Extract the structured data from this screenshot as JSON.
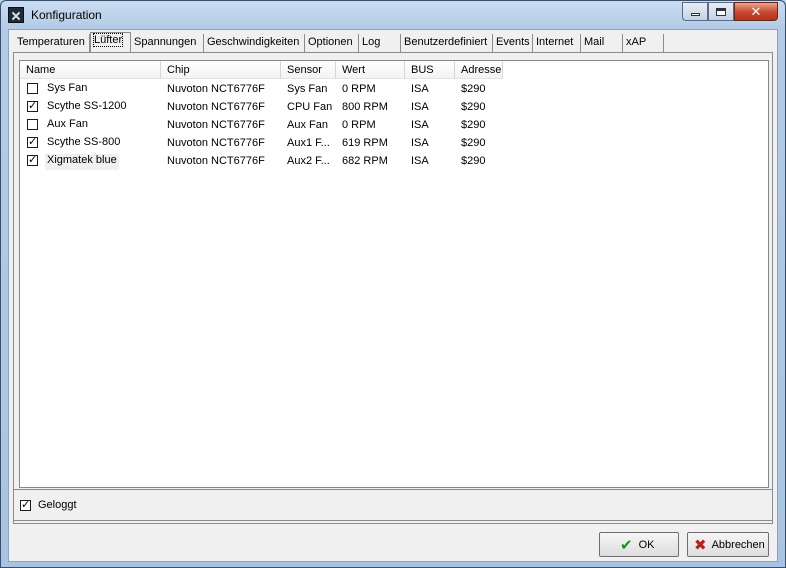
{
  "window": {
    "title": "Konfiguration"
  },
  "tabs": [
    {
      "label": "Temperaturen"
    },
    {
      "label": "Lüfter"
    },
    {
      "label": "Spannungen"
    },
    {
      "label": "Geschwindigkeiten"
    },
    {
      "label": "Optionen"
    },
    {
      "label": "Log"
    },
    {
      "label": "Benutzerdefiniert"
    },
    {
      "label": "Events"
    },
    {
      "label": "Internet"
    },
    {
      "label": "Mail"
    },
    {
      "label": "xAP"
    }
  ],
  "active_tab": "Lüfter",
  "table": {
    "columns": [
      "Name",
      "Chip",
      "Sensor",
      "Wert",
      "BUS",
      "Adresse"
    ],
    "rows": [
      {
        "checked": false,
        "name": "Sys Fan",
        "chip": "Nuvoton NCT6776F",
        "sensor": "Sys Fan",
        "value": "0 RPM",
        "bus": "ISA",
        "address": "$290"
      },
      {
        "checked": true,
        "name": "Scythe SS-1200",
        "chip": "Nuvoton NCT6776F",
        "sensor": "CPU Fan",
        "value": "800 RPM",
        "bus": "ISA",
        "address": "$290"
      },
      {
        "checked": false,
        "name": "Aux Fan",
        "chip": "Nuvoton NCT6776F",
        "sensor": "Aux Fan",
        "value": "0 RPM",
        "bus": "ISA",
        "address": "$290"
      },
      {
        "checked": true,
        "name": "Scythe SS-800",
        "chip": "Nuvoton NCT6776F",
        "sensor": "Aux1 F...",
        "value": "619 RPM",
        "bus": "ISA",
        "address": "$290"
      },
      {
        "checked": true,
        "name": "Xigmatek blue",
        "chip": "Nuvoton NCT6776F",
        "sensor": "Aux2 F...",
        "value": "682 RPM",
        "bus": "ISA",
        "address": "$290"
      }
    ]
  },
  "logged": {
    "label": "Geloggt",
    "checked": true
  },
  "buttons": {
    "ok": "OK",
    "cancel": "Abbrechen"
  },
  "icons": {
    "ok": "checkmark-icon",
    "cancel": "x-icon"
  },
  "colors": {
    "window_frame": "#b3cbe6",
    "close_button": "#c7462c",
    "ok_icon": "#1e8f1e",
    "cancel_icon": "#b3221a"
  }
}
